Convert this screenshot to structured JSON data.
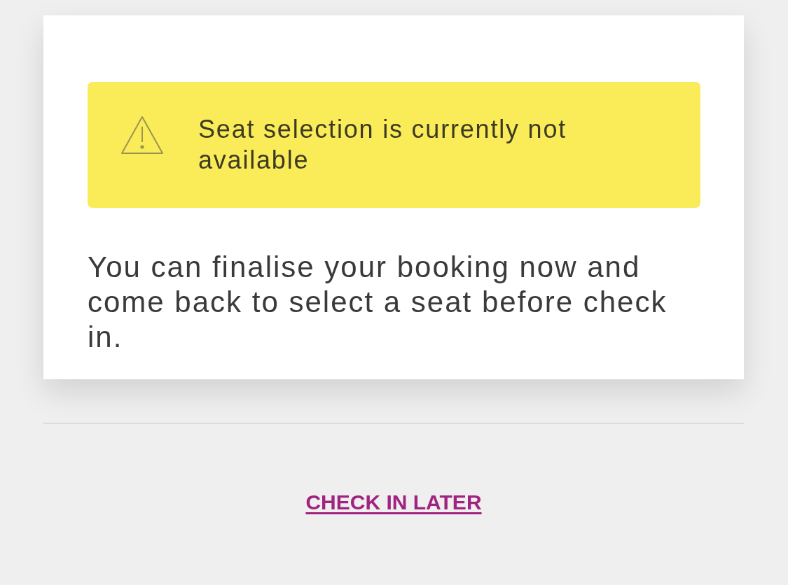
{
  "card": {
    "alert": {
      "kind": "warning",
      "message": "Seat selection is currently not available"
    },
    "message": "You can finalise your booking now and come back to select a seat before check in."
  },
  "link": "CHECK IN LATER"
}
